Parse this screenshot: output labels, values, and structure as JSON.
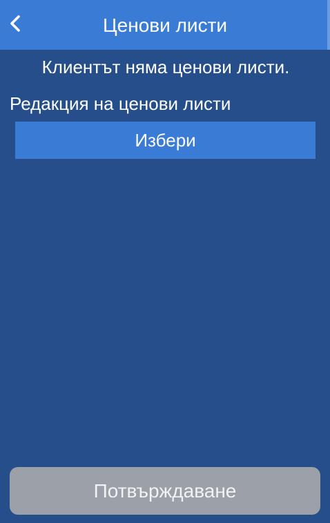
{
  "header": {
    "title": "Ценови листи",
    "back_icon": "chevron-left-icon"
  },
  "main": {
    "empty_message": "Клиентът няма ценови листи.",
    "section_label": "Редакция на ценови листи",
    "select_button_label": "Избери"
  },
  "footer": {
    "confirm_button_label": "Потвърждаване",
    "confirm_disabled": true
  },
  "colors": {
    "background": "#254e8a",
    "accent": "#3a7bd5",
    "disabled_button": "#9ca0a8",
    "text": "#ffffff"
  }
}
